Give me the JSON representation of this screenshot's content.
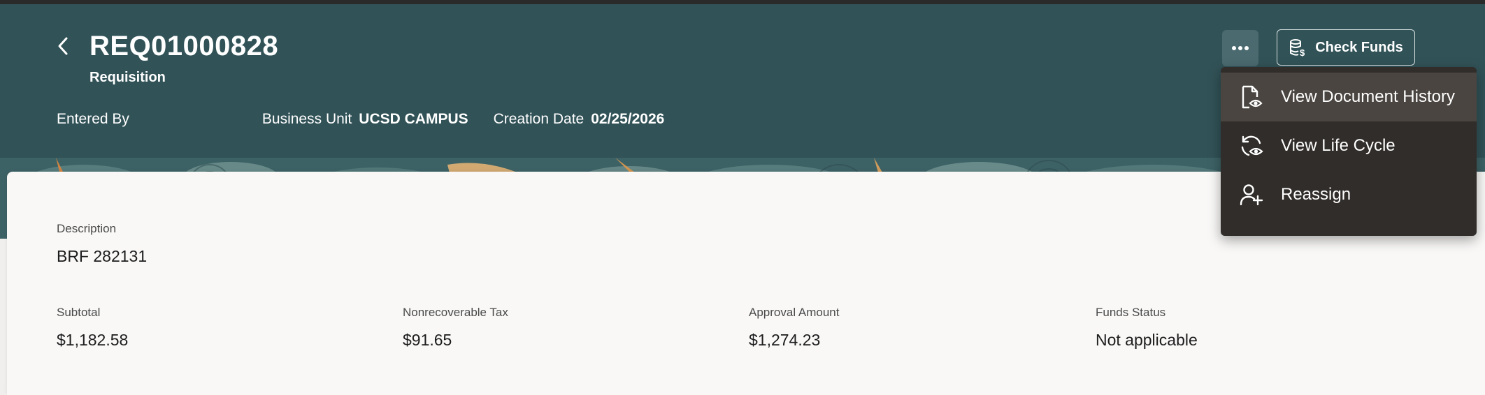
{
  "header": {
    "title": "REQ01000828",
    "subtitle": "Requisition",
    "entered_by_label": "Entered By",
    "entered_by_value": "",
    "business_unit_label": "Business Unit",
    "business_unit_value": "UCSD CAMPUS",
    "creation_date_label": "Creation Date",
    "creation_date_value": "02/25/2026",
    "check_funds_label": "Check Funds",
    "more_actions_icon": "ellipsis-icon",
    "back_icon": "chevron-left-icon"
  },
  "menu": {
    "items": [
      {
        "label": "View Document History",
        "icon": "document-eye-icon",
        "active": true
      },
      {
        "label": "View Life Cycle",
        "icon": "cycle-eye-icon",
        "active": false
      },
      {
        "label": "Reassign",
        "icon": "user-add-icon",
        "active": false
      }
    ]
  },
  "details": {
    "description_label": "Description",
    "description_value": "BRF 282131",
    "subtotal_label": "Subtotal",
    "subtotal_value": "$1,182.58",
    "tax_label": "Nonrecoverable Tax",
    "tax_value": "$91.65",
    "approval_label": "Approval Amount",
    "approval_value": "$1,274.23",
    "funds_label": "Funds Status",
    "funds_value": "Not applicable"
  },
  "colors": {
    "header_bg": "#315257",
    "menu_bg": "#312d2a",
    "card_bg": "#f9f8f7"
  }
}
